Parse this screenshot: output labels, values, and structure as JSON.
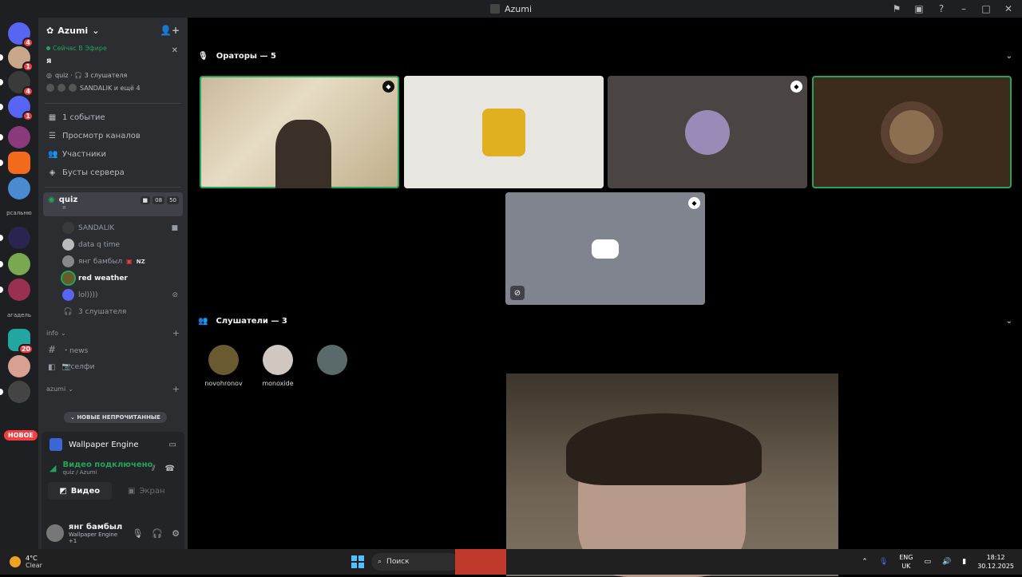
{
  "window": {
    "title": "Azumi"
  },
  "guild": {
    "name": "Azumi",
    "chevron": "⌄"
  },
  "servers": {
    "badges": [
      "4",
      "1",
      "4",
      "1",
      "20"
    ],
    "label1": "рсальню",
    "label2": "агадель",
    "new_label": "НОВОЕ"
  },
  "live": {
    "status": "Сейчас В Эфире",
    "me": "я",
    "channel_info": "quiz · 🎧 3 слушателя",
    "members_info": "SANDALIK и ещё 4"
  },
  "menu": [
    "1 событие",
    "Просмотр каналов",
    "Участники",
    "Бусты сервера"
  ],
  "voice_channel": {
    "name": "quiz",
    "sub": "я",
    "count_video": "08",
    "count_users": "50"
  },
  "members": [
    {
      "name": "SANDALIK",
      "bold": false
    },
    {
      "name": "data q time",
      "bold": false
    },
    {
      "name": "янг бамбыл",
      "tag": "NZ",
      "bold": false
    },
    {
      "name": "red weather",
      "bold": true
    },
    {
      "name": "lol))))",
      "bold": false
    },
    {
      "name": "3 слушателя",
      "bold": false
    }
  ],
  "categories": [
    {
      "name": "info",
      "channels": [
        "・news",
        "📷селфи"
      ]
    },
    {
      "name": "azumi",
      "channels": []
    }
  ],
  "unread_label": "НОВЫЕ НЕПРОЧИТАННЫЕ",
  "activity": {
    "app_name": "Wallpaper Engine",
    "connected": "Видео подключено",
    "route": "quiz / Azumi",
    "tab_video": "Видео",
    "tab_screen": "Экран"
  },
  "user": {
    "name": "янг бамбыл",
    "status": "Wallpaper Engine +1"
  },
  "speakers": {
    "header": "Ораторы — 5"
  },
  "listeners": {
    "header": "Слушатели — 3",
    "items": [
      "novohronov",
      "monoxide",
      ""
    ]
  },
  "taskbar": {
    "temp": "4°C",
    "weather": "Clear",
    "search": "Поиск",
    "lang1": "ENG",
    "lang2": "UK",
    "time": "18:12",
    "date": "30.12.2025"
  },
  "colors": {
    "accent_green": "#23a55a",
    "badge_red": "#f23f43",
    "blurple": "#5865f2"
  }
}
